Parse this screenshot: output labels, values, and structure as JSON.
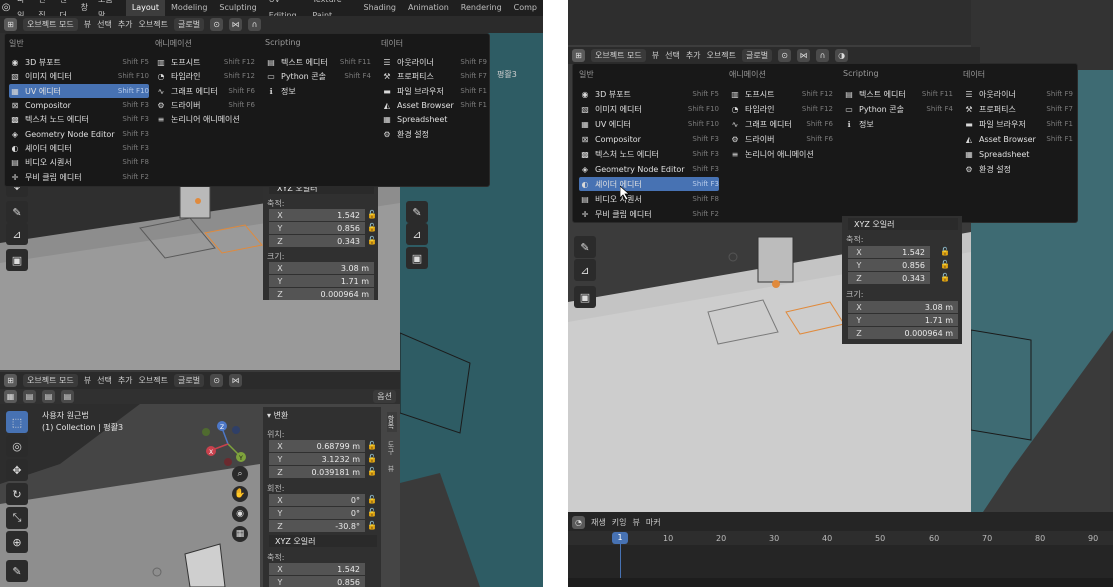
{
  "topbar": {
    "menus": [
      "파일",
      "편집",
      "렌더",
      "창",
      "도움말"
    ],
    "workspaces": [
      "Layout",
      "Modeling",
      "Sculpting",
      "UV Editing",
      "Texture Paint",
      "Shading",
      "Animation",
      "Rendering",
      "Comp"
    ],
    "active_workspace": "Layout"
  },
  "viewport_header": {
    "mode": "오브젝트 모드",
    "view": "뷰",
    "select": "선택",
    "add": "추가",
    "object": "오브젝트",
    "orientation": "글로벌",
    "options": "옵션"
  },
  "editor_menu": {
    "columns": [
      {
        "title": "일반",
        "items": [
          {
            "label": "3D 뷰포트",
            "shortcut": "Shift F5",
            "icon": "viewport-icon"
          },
          {
            "label": "이미지 에디터",
            "shortcut": "Shift F10",
            "icon": "image-icon"
          },
          {
            "label": "UV 에디터",
            "shortcut": "Shift F10",
            "icon": "uv-icon"
          },
          {
            "label": "Compositor",
            "shortcut": "Shift F3",
            "icon": "compositor-icon"
          },
          {
            "label": "텍스처 노드 에디터",
            "shortcut": "Shift F3",
            "icon": "texture-node-icon"
          },
          {
            "label": "Geometry Node Editor",
            "shortcut": "Shift F3",
            "icon": "geometry-node-icon"
          },
          {
            "label": "셰이더 에디터",
            "shortcut": "Shift F3",
            "icon": "shader-icon"
          },
          {
            "label": "비디오 시퀀서",
            "shortcut": "Shift F8",
            "icon": "sequencer-icon"
          },
          {
            "label": "무비 클립 에디터",
            "shortcut": "Shift F2",
            "icon": "clip-icon"
          }
        ]
      },
      {
        "title": "애니메이션",
        "items": [
          {
            "label": "도프시트",
            "shortcut": "Shift F12",
            "icon": "dopesheet-icon"
          },
          {
            "label": "타임라인",
            "shortcut": "Shift F12",
            "icon": "timeline-icon"
          },
          {
            "label": "그래프 에디터",
            "shortcut": "Shift F6",
            "icon": "graph-icon"
          },
          {
            "label": "드라이버",
            "shortcut": "Shift F6",
            "icon": "driver-icon"
          },
          {
            "label": "논리니어 애니메이션",
            "shortcut": "",
            "icon": "nla-icon"
          }
        ]
      },
      {
        "title": "Scripting",
        "items": [
          {
            "label": "텍스트 에디터",
            "shortcut": "Shift F11",
            "icon": "text-icon"
          },
          {
            "label": "Python 콘솔",
            "shortcut": "Shift F4",
            "icon": "console-icon"
          },
          {
            "label": "정보",
            "shortcut": "",
            "icon": "info-icon"
          }
        ]
      },
      {
        "title": "데이터",
        "items": [
          {
            "label": "아웃라이너",
            "shortcut": "Shift F9",
            "icon": "outliner-icon"
          },
          {
            "label": "프로퍼티스",
            "shortcut": "Shift F7",
            "icon": "properties-icon"
          },
          {
            "label": "파일 브라우저",
            "shortcut": "Shift F1",
            "icon": "file-icon"
          },
          {
            "label": "Asset Browser",
            "shortcut": "Shift F1",
            "icon": "asset-icon"
          },
          {
            "label": "Spreadsheet",
            "shortcut": "",
            "icon": "spreadsheet-icon"
          },
          {
            "label": "환경 설정",
            "shortcut": "",
            "icon": "prefs-icon"
          }
        ]
      }
    ]
  },
  "left_menu_highlight": "UV 에디터",
  "right_menu_highlight": "셰이더 에디터",
  "transform": {
    "title": "변환",
    "location_label": "위치:",
    "location": [
      "0.68799 m",
      "3.1232 m",
      "0.039181 m"
    ],
    "rotation_label": "회전:",
    "rotation": [
      "0°",
      "0°",
      "-30.8°"
    ],
    "rotation_mode": "XYZ 오일러",
    "scale_label": "축적:",
    "scale": [
      "1.542",
      "0.856",
      "0.343"
    ],
    "dimensions_label": "크기:",
    "dimensions": [
      "3.08 m",
      "1.71 m",
      "0.000964 m"
    ],
    "axes": [
      "X",
      "Y",
      "Z"
    ]
  },
  "viewport_info": {
    "view_name": "사용자 원근법",
    "collection": "(1) Collection | 평활3",
    "top_right_label": "평활3"
  },
  "side_tabs": [
    "항목",
    "도구",
    "뷰"
  ],
  "timeline": {
    "playback": "재생",
    "keying": "키잉",
    "view": "뷰",
    "marker": "마커",
    "current_frame": "1",
    "ticks": [
      "10",
      "20",
      "30",
      "40",
      "50",
      "60",
      "70",
      "80",
      "90"
    ]
  },
  "colors": {
    "accent": "#4772b3",
    "teal": "#3f6f78"
  }
}
